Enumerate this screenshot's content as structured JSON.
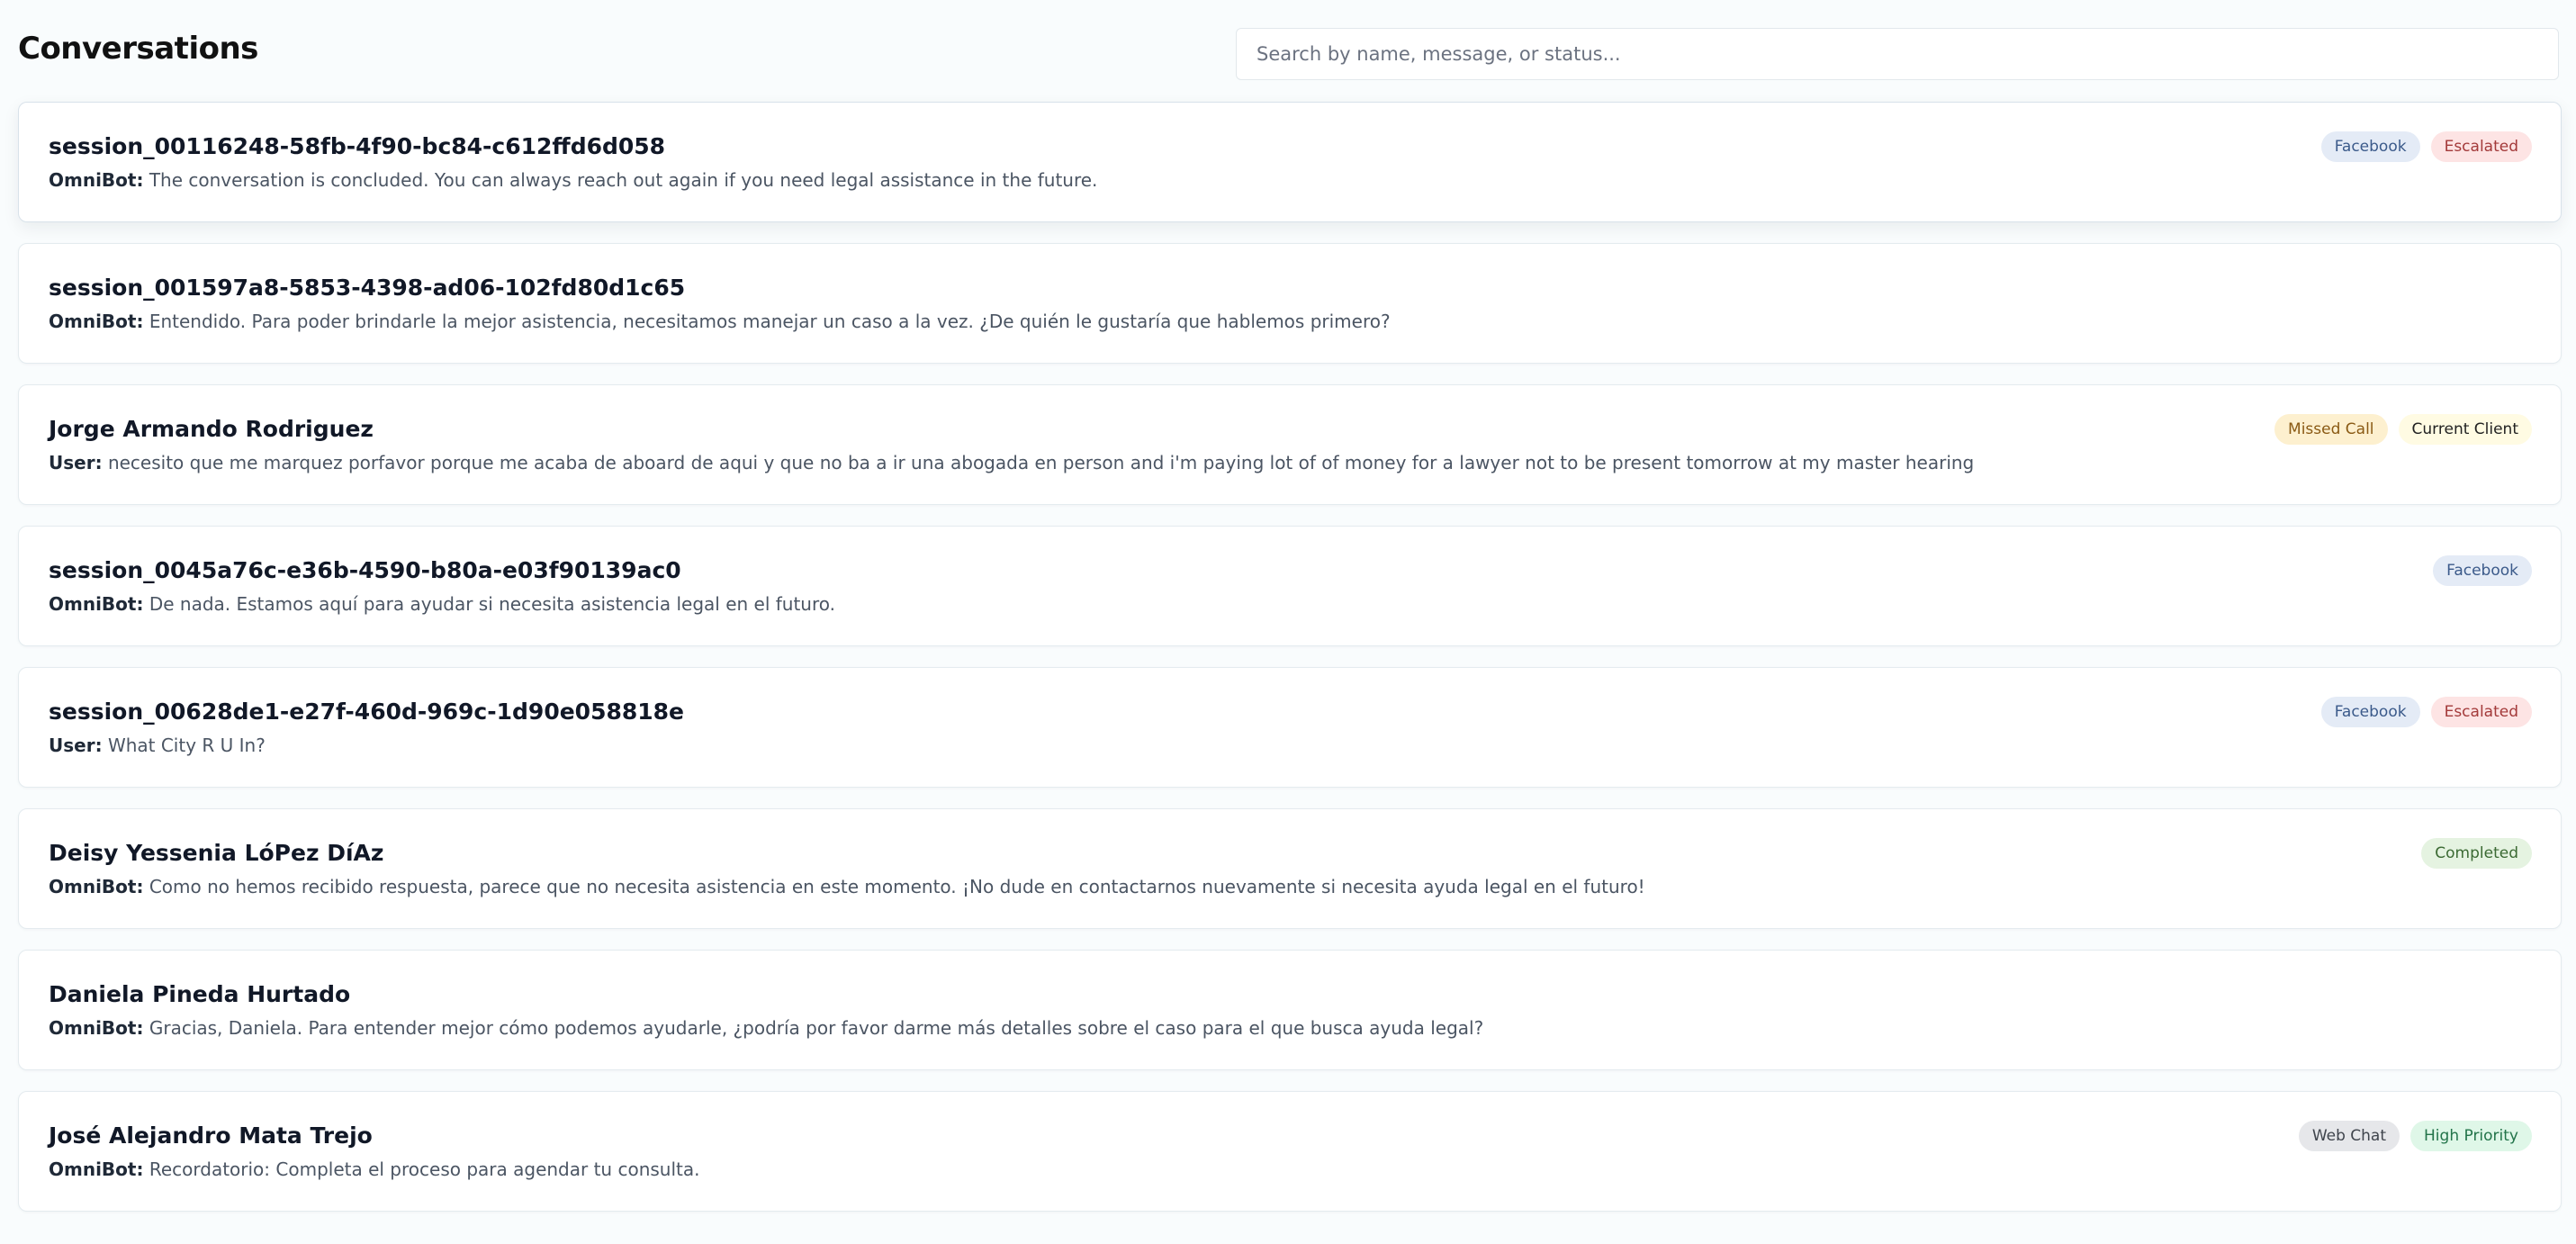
{
  "header": {
    "title": "Conversations",
    "search_placeholder": "Search by name, message, or status..."
  },
  "conversations": [
    {
      "title": "session_00116248-58fb-4f90-bc84-c612ffd6d058",
      "sender": "OmniBot:",
      "message": "The conversation is concluded. You can always reach out again if you need legal assistance in the future.",
      "tags": [
        "Facebook",
        "Escalated"
      ]
    },
    {
      "title": "session_001597a8-5853-4398-ad06-102fd80d1c65",
      "sender": "OmniBot:",
      "message": "Entendido. Para poder brindarle la mejor asistencia, necesitamos manejar un caso a la vez. ¿De quién le gustaría que hablemos primero?",
      "tags": []
    },
    {
      "title": "Jorge Armando Rodriguez",
      "sender": "User:",
      "message": "necesito que me marquez porfavor porque me acaba de aboard de aqui y que no ba a ir una abogada en person and i'm paying lot of of money for a lawyer not to be present tomorrow at my master hearing",
      "tags": [
        "Missed Call",
        "Current Client"
      ]
    },
    {
      "title": "session_0045a76c-e36b-4590-b80a-e03f90139ac0",
      "sender": "OmniBot:",
      "message": "De nada. Estamos aquí para ayudar si necesita asistencia legal en el futuro.",
      "tags": [
        "Facebook"
      ]
    },
    {
      "title": "session_00628de1-e27f-460d-969c-1d90e058818e",
      "sender": "User:",
      "message": "What City R U In?",
      "tags": [
        "Facebook",
        "Escalated"
      ]
    },
    {
      "title": "Deisy Yessenia LóPez DíAz",
      "sender": "OmniBot:",
      "message": "Como no hemos recibido respuesta, parece que no necesita asistencia en este momento. ¡No dude en contactarnos nuevamente si necesita ayuda legal en el futuro!",
      "tags": [
        "Completed"
      ]
    },
    {
      "title": "Daniela Pineda Hurtado",
      "sender": "OmniBot:",
      "message": "Gracias, Daniela. Para entender mejor cómo podemos ayudarle, ¿podría por favor darme más detalles sobre el caso para el que busca ayuda legal?",
      "tags": []
    },
    {
      "title": "José Alejandro Mata Trejo",
      "sender": "OmniBot:",
      "message": "Recordatorio: Completa el proceso para agendar tu consulta.",
      "tags": [
        "Web Chat",
        "High Priority"
      ]
    }
  ]
}
